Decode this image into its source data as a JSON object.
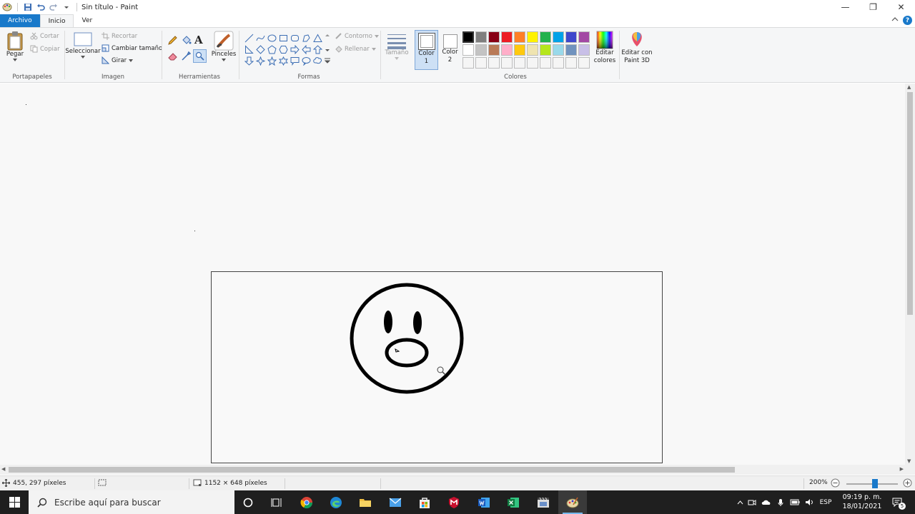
{
  "window": {
    "title": "Sin título - Paint",
    "minimize_glyph": "—",
    "restore_glyph": "❐",
    "close_glyph": "✕"
  },
  "tabs": {
    "file": "Archivo",
    "home": "Inicio",
    "view": "Ver"
  },
  "clipboard": {
    "label": "Portapapeles",
    "paste": "Pegar",
    "cut": "Cortar",
    "copy": "Copiar"
  },
  "image": {
    "label": "Imagen",
    "select": "Seleccionar",
    "crop": "Recortar",
    "resize": "Cambiar tamaño",
    "rotate": "Girar"
  },
  "tools": {
    "label": "Herramientas",
    "brushes": "Pinceles"
  },
  "shapes": {
    "label": "Formas",
    "outline": "Contorno",
    "fill": "Rellenar",
    "size": "Tamaño"
  },
  "colors": {
    "label": "Colores",
    "color1_line1": "Color",
    "color1_line2": "1",
    "color2_line1": "Color",
    "color2_line2": "2",
    "edit_line1": "Editar",
    "edit_line2": "colores",
    "paint3d_line1": "Editar con",
    "paint3d_line2": "Paint 3D",
    "palette_row1": [
      "#000000",
      "#7f7f7f",
      "#880015",
      "#ed1c24",
      "#ff7f27",
      "#fff200",
      "#22b14c",
      "#00a2e8",
      "#3f48cc",
      "#a349a4"
    ],
    "palette_row2": [
      "#ffffff",
      "#c3c3c3",
      "#b97a57",
      "#ffaec9",
      "#ffc90e",
      "#efe4b0",
      "#b5e61d",
      "#99d9ea",
      "#7092be",
      "#c8bfe7"
    ],
    "palette_row3": [
      "#f5f5f5",
      "#f5f5f5",
      "#f5f5f5",
      "#f5f5f5",
      "#f5f5f5",
      "#f5f5f5",
      "#f5f5f5",
      "#f5f5f5",
      "#f5f5f5",
      "#f5f5f5"
    ]
  },
  "status": {
    "cursor_pos": "455, 297 píxeles",
    "canvas_size": "1152 × 648 píxeles",
    "zoom": "200%",
    "zoom_level_fraction": 0.55
  },
  "taskbar": {
    "search_placeholder": "Escribe aquí para buscar",
    "language": "ESP",
    "time": "09:19 p. m.",
    "date": "18/01/2021",
    "notification_count": "5"
  }
}
